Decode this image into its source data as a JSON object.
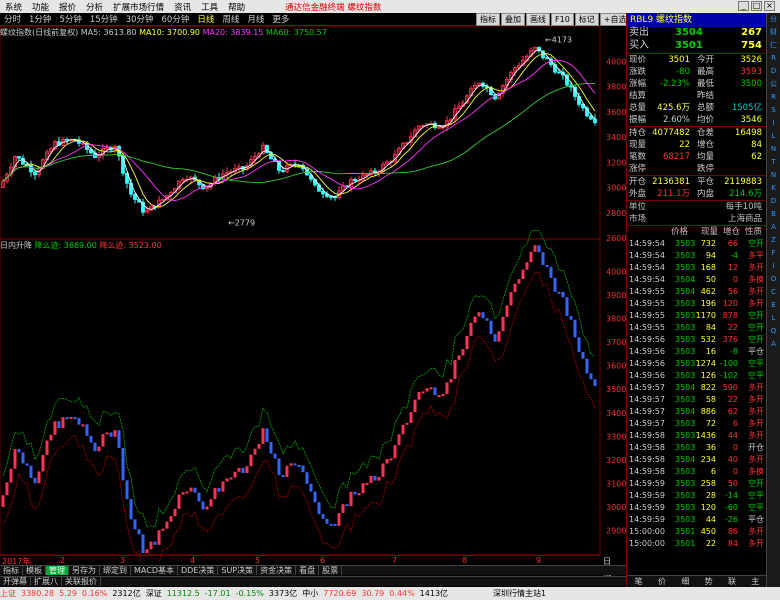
{
  "menu": {
    "items": [
      "系统",
      "功能",
      "报价",
      "分析",
      "扩展市场行情",
      "资讯",
      "工具",
      "帮助"
    ],
    "center": "通达信金融终端",
    "center2": "螺纹指数"
  },
  "toolbar": {
    "items": [
      "分时",
      "1分钟",
      "5分钟",
      "15分钟",
      "30分钟",
      "60分钟",
      "日线",
      "周线",
      "月线",
      "更多"
    ],
    "active": 6,
    "right": [
      "指标",
      "叠加",
      "画线",
      "F10",
      "标记",
      "+自选",
      "返回"
    ]
  },
  "ma": {
    "title": "螺纹指数(日线前复权)",
    "ma5": "MA5: 3613.80",
    "ma10": "MA10: 3700.90",
    "ma20": "MA20: 3839.15",
    "ma60": "MA60: 3750.57"
  },
  "lower": {
    "title": "日内升降",
    "up": "降么迹: 3669.00",
    "down": "降么迹: 3523.00"
  },
  "upper_axis": [
    "4000",
    "3800",
    "3600",
    "3400",
    "3200",
    "3000",
    "2800",
    "2600"
  ],
  "lower_axis": [
    "4000",
    "3900",
    "3800",
    "3700",
    "3600",
    "3500",
    "3400",
    "3300",
    "3200",
    "3100",
    "3000",
    "2900"
  ],
  "annot": {
    "high": "4173",
    "low": "2779"
  },
  "dates": [
    {
      "t": "2017年"
    },
    {
      "t": "2"
    },
    {
      "t": "3"
    },
    {
      "t": "4"
    },
    {
      "t": "5"
    },
    {
      "t": "6"
    },
    {
      "t": "7"
    },
    {
      "t": "8"
    },
    {
      "t": "9"
    }
  ],
  "date_suffix": "日线",
  "tabs": [
    "指标",
    "模板",
    "管理",
    "另存为",
    "绑定到",
    "MACD基本",
    "DDE决策",
    "SUP决策",
    "资金决策",
    "看盘",
    "股票"
  ],
  "active_tab": 2,
  "tabs2": [
    "开弹幕",
    "扩展八",
    "关联报价"
  ],
  "panel": {
    "title_code": "RBL9",
    "title_name": "螺纹指数",
    "sell": {
      "label": "卖出",
      "price": "3504",
      "vol": "267"
    },
    "buy": {
      "label": "买入",
      "price": "3501",
      "vol": "754"
    },
    "q": [
      {
        "a": "现价",
        "b": "3501",
        "c": "今开",
        "d": "3526"
      },
      {
        "a": "涨跌",
        "b": "-80",
        "c": "最高",
        "d": "3593"
      },
      {
        "a": "涨幅",
        "b": "-2.23%",
        "c": "最低",
        "d": "3500"
      },
      {
        "a": "结算",
        "b": "",
        "c": "昨结",
        "d": ""
      },
      {
        "a": "总量",
        "b": "425.6万",
        "c": "总额",
        "d": "1505亿"
      },
      {
        "a": "振幅",
        "b": "2.60%",
        "c": "均价",
        "d": "3546"
      }
    ],
    "q2": [
      {
        "a": "持仓",
        "b": "4077482",
        "c": "仓差",
        "d": "16498"
      },
      {
        "a": "现量",
        "b": "22",
        "c": "增仓",
        "d": "84"
      },
      {
        "a": "笔数",
        "b": "68217",
        "c": "均量",
        "d": "62"
      },
      {
        "a": "涨停",
        "b": "",
        "c": "跌停",
        "d": ""
      }
    ],
    "q3": [
      {
        "a": "开仓",
        "b": "2136381",
        "c": "平仓",
        "d": "2119883"
      },
      {
        "a": "外盘",
        "b": "211.1万",
        "c": "内盘",
        "d": "214.6万"
      }
    ],
    "unit": {
      "a": "单位",
      "b": "每手10吨",
      "c": "市场",
      "d": "上海商品"
    },
    "tick_hdr": [
      "价格",
      "现量",
      "增仓",
      "性质"
    ],
    "ticks": [
      [
        "14:59:54",
        "3503",
        "732",
        "66",
        "空开"
      ],
      [
        "14:59:54",
        "3503",
        "94",
        "-4",
        "多平"
      ],
      [
        "14:59:54",
        "3503",
        "168",
        "12",
        "多开"
      ],
      [
        "14:59:54",
        "3504",
        "50",
        "0",
        "多换"
      ],
      [
        "14:59:55",
        "3504",
        "462",
        "56",
        "多开"
      ],
      [
        "14:59:55",
        "3503",
        "196",
        "120",
        "多开"
      ],
      [
        "14:59:55",
        "3503",
        "1170",
        "878",
        "空开"
      ],
      [
        "14:59:55",
        "3503",
        "84",
        "22",
        "空开"
      ],
      [
        "14:59:56",
        "3503",
        "532",
        "376",
        "空开"
      ],
      [
        "14:59:56",
        "3503",
        "16",
        "-8",
        "平仓"
      ],
      [
        "14:59:56",
        "3503",
        "1274",
        "-100",
        "空平"
      ],
      [
        "14:59:56",
        "3503",
        "126",
        "-102",
        "空平"
      ],
      [
        "14:59:57",
        "3504",
        "822",
        "590",
        "多开"
      ],
      [
        "14:59:57",
        "3503",
        "58",
        "22",
        "多开"
      ],
      [
        "14:59:57",
        "3504",
        "886",
        "62",
        "多开"
      ],
      [
        "14:59:57",
        "3503",
        "72",
        "6",
        "多开"
      ],
      [
        "14:59:58",
        "3503",
        "1436",
        "44",
        "多开"
      ],
      [
        "14:59:58",
        "3503",
        "36",
        "0",
        "开仓"
      ],
      [
        "14:59:58",
        "3504",
        "234",
        "40",
        "多开"
      ],
      [
        "14:59:58",
        "3503",
        "6",
        "0",
        "多换"
      ],
      [
        "14:59:59",
        "3503",
        "258",
        "50",
        "空开"
      ],
      [
        "14:59:59",
        "3503",
        "28",
        "-14",
        "空平"
      ],
      [
        "14:59:59",
        "3503",
        "120",
        "-60",
        "空平"
      ],
      [
        "14:59:59",
        "3503",
        "44",
        "-26",
        "平仓"
      ],
      [
        "15:00:00",
        "3501",
        "450",
        "86",
        "多开"
      ],
      [
        "15:00:00",
        "3501",
        "22",
        "84",
        "多开"
      ]
    ],
    "bottom": [
      "笔",
      "价",
      "细",
      "势",
      "联",
      "主"
    ]
  },
  "sidebar": [
    "分",
    "财",
    "仁",
    "R",
    "D",
    "公",
    "R",
    "S",
    "I",
    "L",
    "N",
    "T",
    "N",
    "K",
    "D",
    "B",
    "A",
    "Z",
    "F",
    "I",
    "O",
    "C",
    "E",
    "L",
    "Q",
    "A"
  ],
  "status": {
    "sh_label": "上证",
    "sh": "3380.28",
    "sh_chg": "5.29",
    "sh_pct": "0.16%",
    "sh_amt": "2312亿",
    "sz_label": "深证",
    "sz": "11312.5",
    "sz_chg": "-17.01",
    "sz_pct": "-0.15%",
    "sz_amt": "3373亿",
    "zx_label": "中小",
    "zx": "7720.69",
    "zx_chg": "30.79",
    "zx_pct": "0.44%",
    "zx_amt": "1413亿",
    "site": "深圳行情主站1"
  },
  "colors": {
    "up": "#ff3355",
    "down": "#3366ff",
    "ma5": "#ffffff",
    "ma10": "#ffff33",
    "ma20": "#ff33ff",
    "ma60": "#33cc33"
  }
}
